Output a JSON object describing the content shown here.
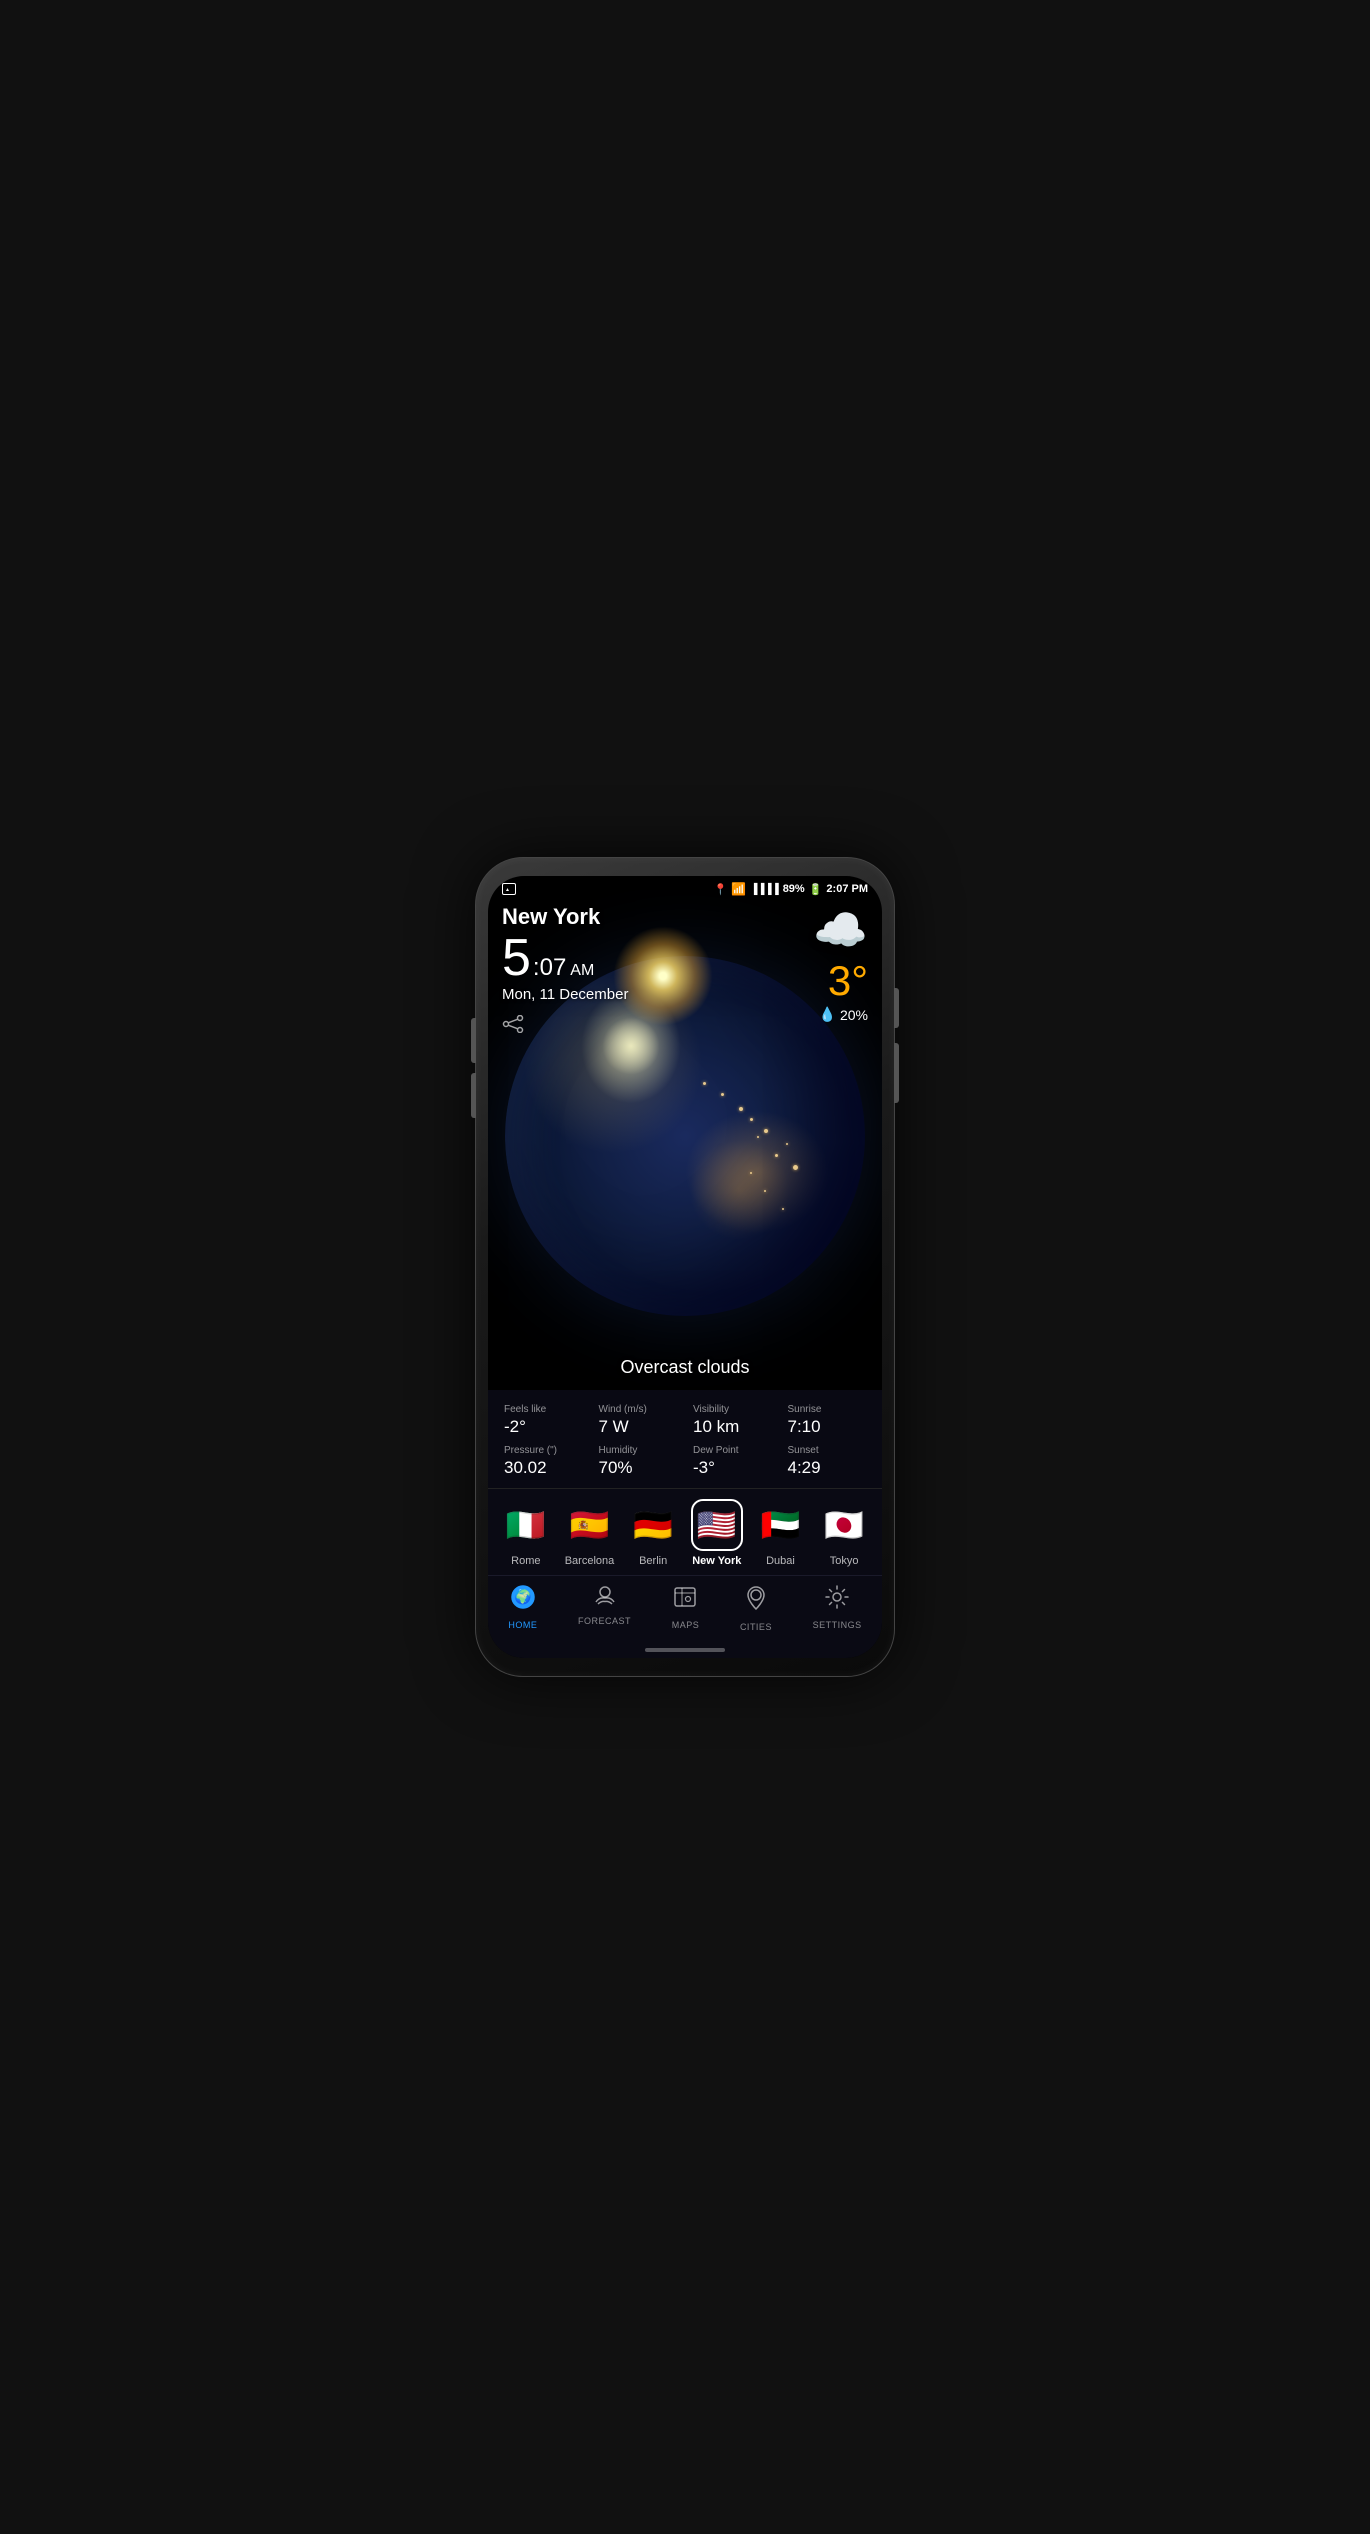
{
  "phone": {
    "status_bar": {
      "location_icon": "📍",
      "wifi_icon": "wifi",
      "signal_icon": "signal",
      "battery": "89%",
      "time": "2:07 PM"
    },
    "weather": {
      "city": "New York",
      "time_hour": "5",
      "time_minutes": "07",
      "time_ampm": "AM",
      "date": "Mon, 11 December",
      "temperature": "3°",
      "precipitation": "20%",
      "condition": "Overcast clouds",
      "details": [
        {
          "label": "Feels like",
          "value": "-2°"
        },
        {
          "label": "Wind (m/s)",
          "value": "7 W"
        },
        {
          "label": "Visibility",
          "value": "10 km"
        },
        {
          "label": "Sunrise",
          "value": "7:10"
        },
        {
          "label": "Pressure (\")",
          "value": "30.02"
        },
        {
          "label": "Humidity",
          "value": "70%"
        },
        {
          "label": "Dew Point",
          "value": "-3°"
        },
        {
          "label": "Sunset",
          "value": "4:29"
        }
      ]
    },
    "cities": [
      {
        "name": "Rome",
        "flag": "🇮🇹",
        "active": false
      },
      {
        "name": "Barcelona",
        "flag": "🇪🇸",
        "active": false
      },
      {
        "name": "Berlin",
        "flag": "🇩🇪",
        "active": false
      },
      {
        "name": "New York",
        "flag": "🇺🇸",
        "active": true
      },
      {
        "name": "Dubai",
        "flag": "🇦🇪",
        "active": false
      },
      {
        "name": "Tokyo",
        "flag": "🇯🇵",
        "active": false
      }
    ],
    "nav": [
      {
        "id": "home",
        "label": "HOME",
        "icon": "🌍",
        "active": true
      },
      {
        "id": "forecast",
        "label": "FORECAST",
        "icon": "⛅",
        "active": false
      },
      {
        "id": "maps",
        "label": "MAPS",
        "icon": "🗺",
        "active": false
      },
      {
        "id": "cities",
        "label": "CITIES",
        "icon": "📍",
        "active": false
      },
      {
        "id": "settings",
        "label": "SETTINGS",
        "icon": "⚙",
        "active": false
      }
    ]
  }
}
